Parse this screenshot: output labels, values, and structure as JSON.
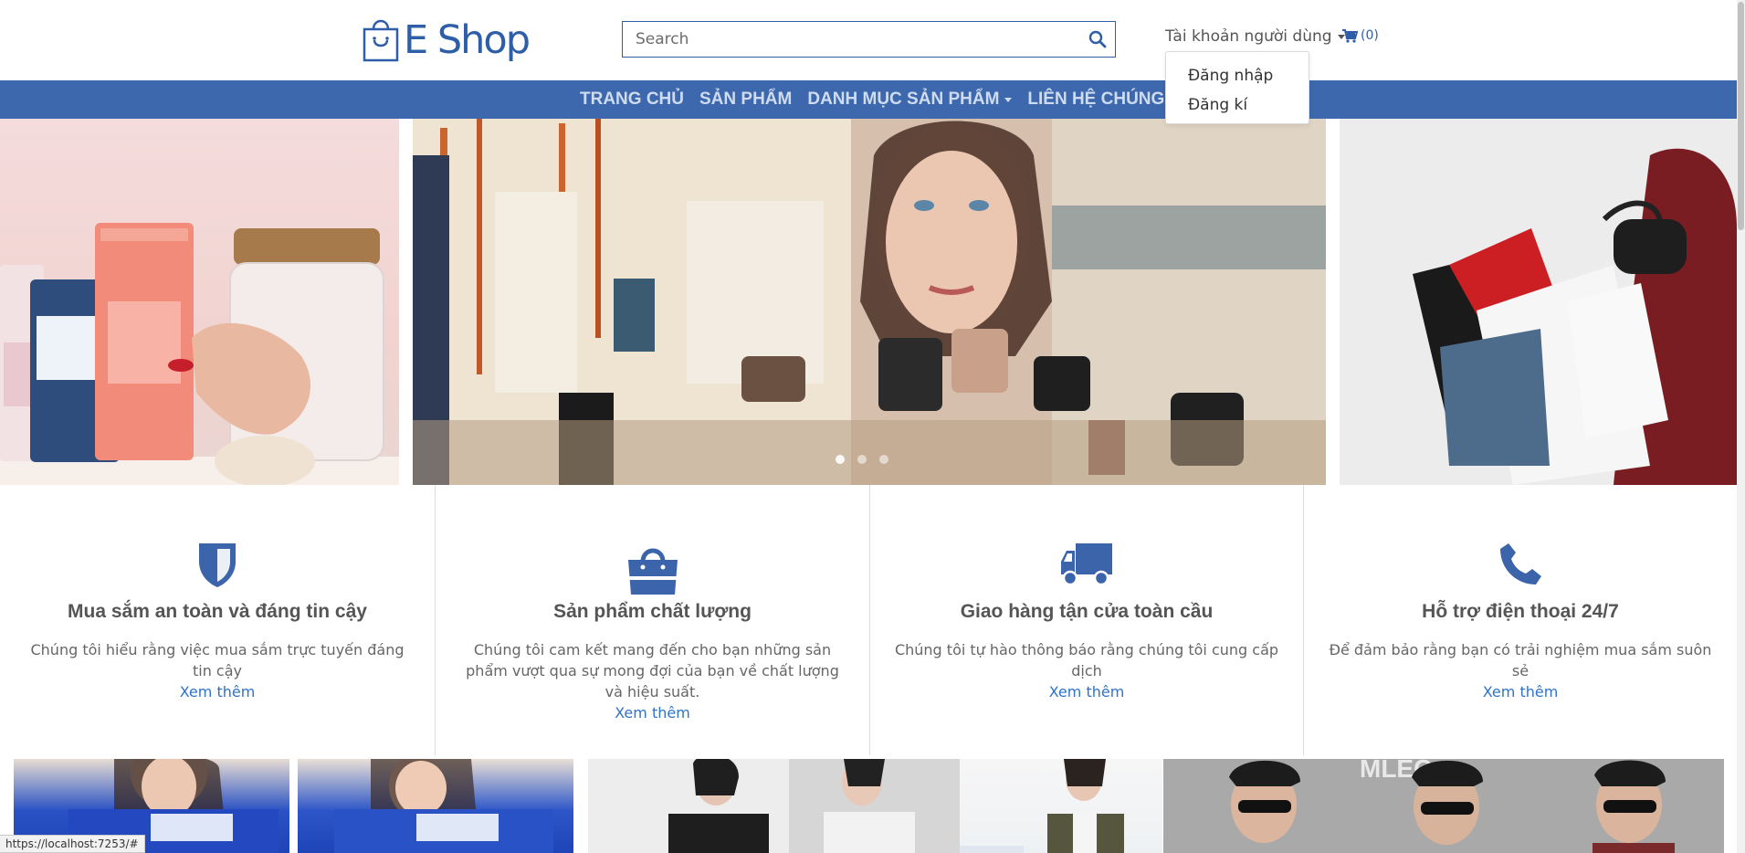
{
  "header": {
    "logo_text": "E Shop",
    "search_placeholder": "Search",
    "account_label": "Tài khoản người dùng",
    "cart_count": "(0)"
  },
  "dropdown": {
    "items": [
      "Đăng nhập",
      "Đăng kí"
    ]
  },
  "nav": {
    "items": [
      "TRANG CHỦ",
      "SẢN PHẨM",
      "DANH MỤC SẢN PHẨM",
      "LIÊN HỆ CHÚNG TÔI"
    ]
  },
  "carousel": {
    "slide_count": 3,
    "active_index": 0
  },
  "features": [
    {
      "icon": "shield-icon",
      "title": "Mua sắm an toàn và đáng tin cậy",
      "description": "Chúng tôi hiểu rằng việc mua sắm trực tuyến đáng tin cậy",
      "link": "Xem thêm"
    },
    {
      "icon": "shopping-bag-icon",
      "title": "Sản phẩm chất lượng",
      "description": "Chúng tôi cam kết mang đến cho bạn những sản phẩm vượt qua sự mong đợi của bạn về chất lượng và hiệu suất.",
      "link": "Xem thêm"
    },
    {
      "icon": "truck-icon",
      "title": "Giao hàng tận cửa toàn cầu",
      "description": "Chúng tôi tự hào thông báo rằng chúng tôi cung cấp dịch",
      "link": "Xem thêm"
    },
    {
      "icon": "phone-icon",
      "title": "Hỗ trợ điện thoại 24/7",
      "description": "Để đảm bảo rằng bạn có trải nghiệm mua sắm suôn sẻ",
      "link": "Xem thêm"
    }
  ],
  "status_bar": {
    "url": "https://localhost:7253/#"
  },
  "colors": {
    "brand": "#2f5ea8",
    "nav_bg": "#3d68ad",
    "link": "#2f73c9"
  }
}
